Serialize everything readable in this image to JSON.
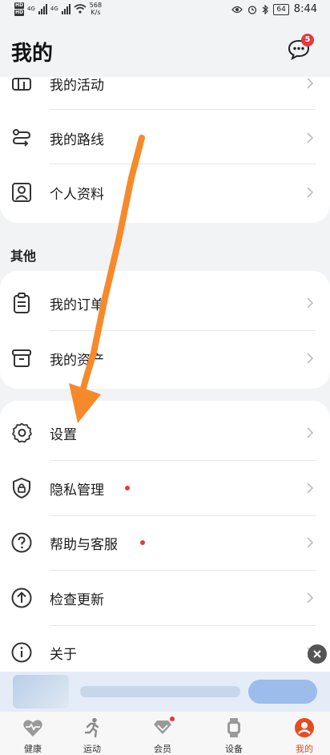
{
  "status_bar": {
    "hd1": "HD",
    "hd2": "HD",
    "net1": "4G",
    "net2": "4G",
    "speed_value": "568",
    "speed_unit": "K/s",
    "battery": "64",
    "time": "8:44"
  },
  "header": {
    "title": "我的",
    "message_badge": "5"
  },
  "group1": {
    "items": [
      {
        "label": "我的活动",
        "icon": "activity-icon"
      },
      {
        "label": "我的路线",
        "icon": "route-icon"
      },
      {
        "label": "个人资料",
        "icon": "profile-icon"
      }
    ]
  },
  "section_other": {
    "title": "其他"
  },
  "group2": {
    "items": [
      {
        "label": "我的订单",
        "icon": "order-icon"
      },
      {
        "label": "我的资产",
        "icon": "asset-icon"
      }
    ]
  },
  "group3": {
    "items": [
      {
        "label": "设置",
        "icon": "gear-icon"
      },
      {
        "label": "隐私管理",
        "icon": "shield-lock-icon"
      },
      {
        "label": "帮助与客服",
        "icon": "help-icon"
      },
      {
        "label": "检查更新",
        "icon": "update-icon"
      },
      {
        "label": "关于",
        "icon": "info-icon"
      }
    ]
  },
  "tabbar": {
    "tabs": [
      {
        "label": "健康",
        "icon": "heart-icon"
      },
      {
        "label": "运动",
        "icon": "runner-icon"
      },
      {
        "label": "会员",
        "icon": "member-icon"
      },
      {
        "label": "设备",
        "icon": "watch-icon"
      },
      {
        "label": "我的",
        "icon": "me-icon"
      }
    ],
    "active_color": "#e84b1f"
  },
  "colors": {
    "badge": "#e8383d",
    "arrow": "#f68a2b"
  }
}
